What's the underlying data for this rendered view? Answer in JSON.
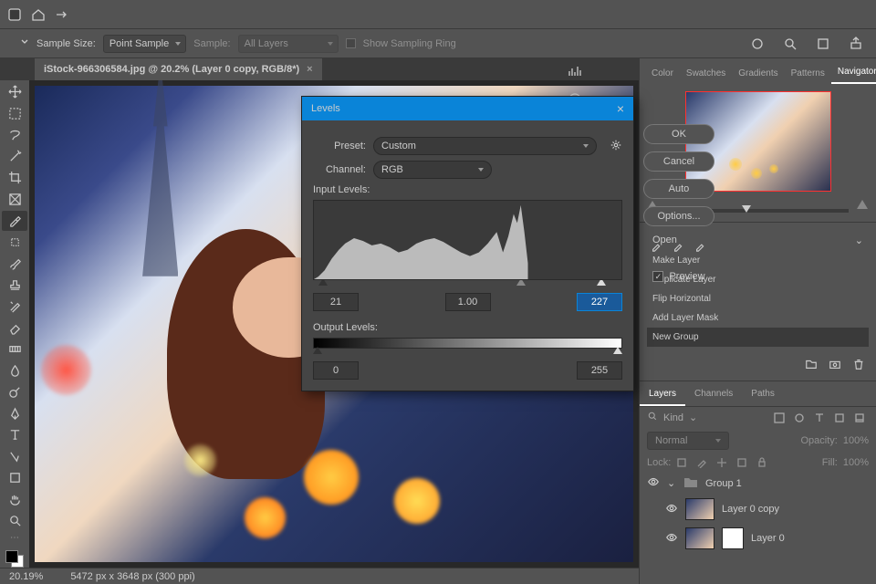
{
  "top": {
    "sample_size_label": "Sample Size:",
    "sample_size": "Point Sample",
    "sample_label": "Sample:",
    "sample": "All Layers",
    "show_ring": "Show Sampling Ring"
  },
  "doc": {
    "title": "iStock-966306584.jpg @ 20.2% (Layer 0 copy, RGB/8*)"
  },
  "status": {
    "zoom": "20.19%",
    "dims": "5472 px x 3648 px (300 ppi)"
  },
  "panels": {
    "tabs": [
      "Color",
      "Swatches",
      "Gradients",
      "Patterns",
      "Navigator"
    ]
  },
  "actions": {
    "header": "Open",
    "items": [
      "Make Layer",
      "Duplicate Layer",
      "Flip Horizontal",
      "Add Layer Mask",
      "New Group"
    ]
  },
  "layer_tabs": [
    "Layers",
    "Channels",
    "Paths"
  ],
  "layers": {
    "kind": "Kind",
    "blend": "Normal",
    "opacity_label": "Opacity:",
    "opacity": "100%",
    "lock": "Lock:",
    "fill_label": "Fill:",
    "fill": "100%",
    "items": [
      "Group 1",
      "Layer 0 copy",
      "Layer 0"
    ]
  },
  "dialog": {
    "title": "Levels",
    "preset_label": "Preset:",
    "preset": "Custom",
    "channel_label": "Channel:",
    "channel": "RGB",
    "input_label": "Input Levels:",
    "in_black": "21",
    "in_mid": "1.00",
    "in_white": "227",
    "output_label": "Output Levels:",
    "out_black": "0",
    "out_white": "255",
    "ok": "OK",
    "cancel": "Cancel",
    "auto": "Auto",
    "options": "Options...",
    "preview": "Preview"
  }
}
